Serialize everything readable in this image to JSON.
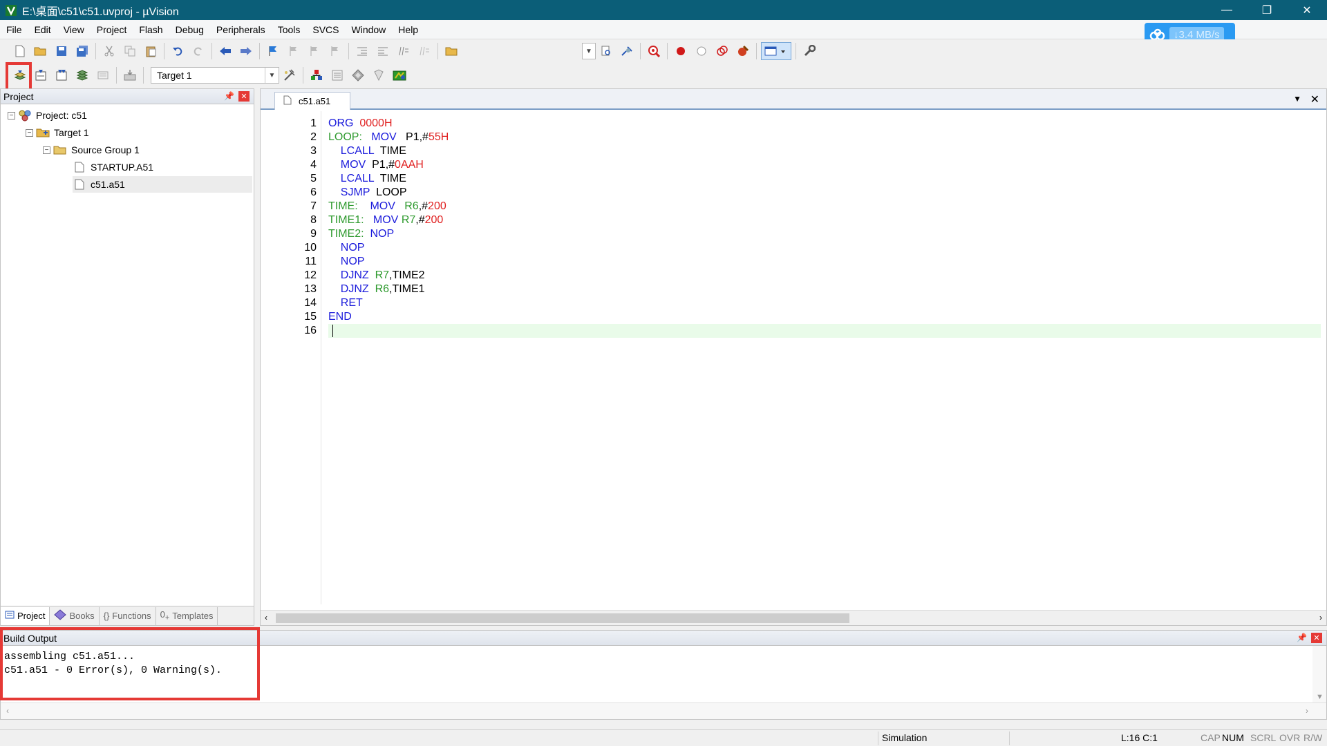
{
  "window": {
    "title": "E:\\桌面\\c51\\c51.uvproj - µVision",
    "minimize": "—",
    "restore": "❐",
    "close": "✕"
  },
  "menu": [
    "File",
    "Edit",
    "View",
    "Project",
    "Flash",
    "Debug",
    "Peripherals",
    "Tools",
    "SVCS",
    "Window",
    "Help"
  ],
  "net_badge": {
    "text": "↓3.4 MB/s"
  },
  "toolbar2": {
    "target": "Target 1"
  },
  "project_panel": {
    "title": "Project",
    "tree": {
      "project": "Project: c51",
      "target": "Target 1",
      "group": "Source Group 1",
      "files": [
        "STARTUP.A51",
        "c51.a51"
      ]
    },
    "tabs": [
      {
        "icon": "project-tab-icon",
        "label": "Project"
      },
      {
        "icon": "books-tab-icon",
        "label": "Books"
      },
      {
        "icon": "functions-tab-icon",
        "label": "Functions"
      },
      {
        "icon": "templates-tab-icon",
        "label": "Templates"
      }
    ]
  },
  "editor": {
    "tab": "c51.a51",
    "line_numbers": [
      "1",
      "2",
      "3",
      "4",
      "5",
      "6",
      "7",
      "8",
      "9",
      "10",
      "11",
      "12",
      "13",
      "14",
      "15",
      "16"
    ],
    "lines": [
      [
        {
          "c": "kw",
          "t": "ORG"
        },
        {
          "c": "txt",
          "t": "  "
        },
        {
          "c": "num",
          "t": "0000H"
        }
      ],
      [
        {
          "c": "lbl",
          "t": "LOOP:"
        },
        {
          "c": "txt",
          "t": "   "
        },
        {
          "c": "kw",
          "t": "MOV"
        },
        {
          "c": "txt",
          "t": "   P1,#"
        },
        {
          "c": "num",
          "t": "55H"
        }
      ],
      [
        {
          "c": "txt",
          "t": "    "
        },
        {
          "c": "kw",
          "t": "LCALL"
        },
        {
          "c": "txt",
          "t": "  TIME"
        }
      ],
      [
        {
          "c": "txt",
          "t": "    "
        },
        {
          "c": "kw",
          "t": "MOV"
        },
        {
          "c": "txt",
          "t": "  P1,#"
        },
        {
          "c": "num",
          "t": "0AAH"
        }
      ],
      [
        {
          "c": "txt",
          "t": "    "
        },
        {
          "c": "kw",
          "t": "LCALL"
        },
        {
          "c": "txt",
          "t": "  TIME"
        }
      ],
      [
        {
          "c": "txt",
          "t": "    "
        },
        {
          "c": "kw",
          "t": "SJMP"
        },
        {
          "c": "txt",
          "t": "  LOOP"
        }
      ],
      [
        {
          "c": "lbl",
          "t": "TIME:"
        },
        {
          "c": "txt",
          "t": "    "
        },
        {
          "c": "kw",
          "t": "MOV"
        },
        {
          "c": "txt",
          "t": "   "
        },
        {
          "c": "reg",
          "t": "R6"
        },
        {
          "c": "txt",
          "t": ",#"
        },
        {
          "c": "num",
          "t": "200"
        }
      ],
      [
        {
          "c": "lbl",
          "t": "TIME1:"
        },
        {
          "c": "txt",
          "t": "   "
        },
        {
          "c": "kw",
          "t": "MOV"
        },
        {
          "c": "txt",
          "t": " "
        },
        {
          "c": "reg",
          "t": "R7"
        },
        {
          "c": "txt",
          "t": ",#"
        },
        {
          "c": "num",
          "t": "200"
        }
      ],
      [
        {
          "c": "lbl",
          "t": "TIME2:"
        },
        {
          "c": "txt",
          "t": "  "
        },
        {
          "c": "kw",
          "t": "NOP"
        }
      ],
      [
        {
          "c": "txt",
          "t": "    "
        },
        {
          "c": "kw",
          "t": "NOP"
        }
      ],
      [
        {
          "c": "txt",
          "t": "    "
        },
        {
          "c": "kw",
          "t": "NOP"
        }
      ],
      [
        {
          "c": "txt",
          "t": "    "
        },
        {
          "c": "kw",
          "t": "DJNZ"
        },
        {
          "c": "txt",
          "t": "  "
        },
        {
          "c": "reg",
          "t": "R7"
        },
        {
          "c": "txt",
          "t": ",TIME2"
        }
      ],
      [
        {
          "c": "txt",
          "t": "    "
        },
        {
          "c": "kw",
          "t": "DJNZ"
        },
        {
          "c": "txt",
          "t": "  "
        },
        {
          "c": "reg",
          "t": "R6"
        },
        {
          "c": "txt",
          "t": ",TIME1"
        }
      ],
      [
        {
          "c": "txt",
          "t": "    "
        },
        {
          "c": "kw",
          "t": "RET"
        }
      ],
      [
        {
          "c": "kw",
          "t": "END"
        }
      ],
      []
    ]
  },
  "build_output": {
    "title": "Build Output",
    "lines": [
      "assembling c51.a51...",
      "c51.a51 - 0 Error(s), 0 Warning(s)."
    ]
  },
  "statusbar": {
    "mode": "Simulation",
    "position": "L:16 C:1",
    "cap": "CAP",
    "num": "NUM",
    "scrl": "SCRL",
    "ovr": "OVR",
    "rw": "R/W"
  },
  "colors": {
    "titlebar": "#0b5e78",
    "keyword": "#1a1adb",
    "number": "#e02020",
    "label": "#2e9a2e",
    "highlight": "#e53935"
  }
}
